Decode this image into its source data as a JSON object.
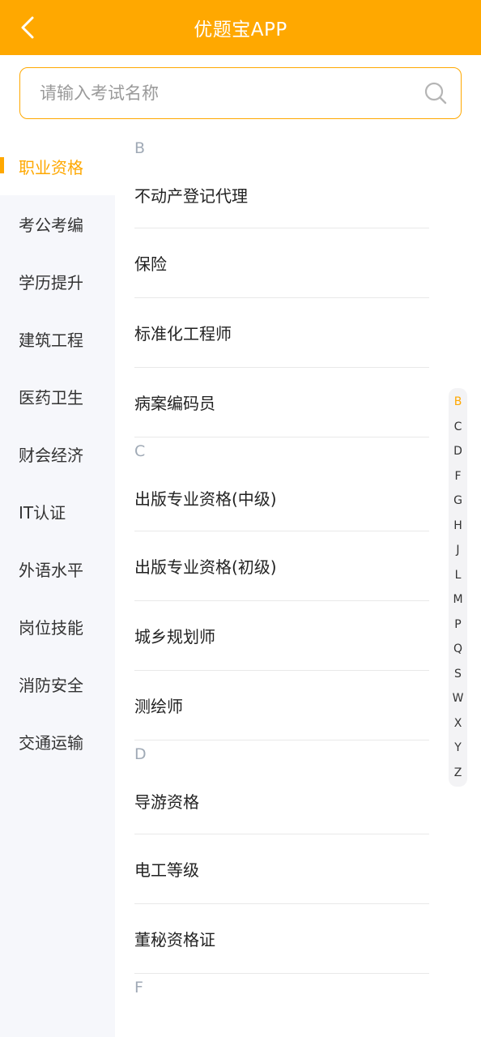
{
  "header": {
    "title": "优题宝APP"
  },
  "search": {
    "placeholder": "请输入考试名称",
    "value": ""
  },
  "sidebar": {
    "items": [
      {
        "label": "职业资格",
        "active": true
      },
      {
        "label": "考公考编",
        "active": false
      },
      {
        "label": "学历提升",
        "active": false
      },
      {
        "label": "建筑工程",
        "active": false
      },
      {
        "label": "医药卫生",
        "active": false
      },
      {
        "label": "财会经济",
        "active": false
      },
      {
        "label": "IT认证",
        "active": false
      },
      {
        "label": "外语水平",
        "active": false
      },
      {
        "label": "岗位技能",
        "active": false
      },
      {
        "label": "消防安全",
        "active": false
      },
      {
        "label": "交通运输",
        "active": false
      }
    ]
  },
  "groups": [
    {
      "letter": "B",
      "items": [
        "不动产登记代理",
        "保险",
        "标准化工程师",
        "病案编码员"
      ]
    },
    {
      "letter": "C",
      "items": [
        "出版专业资格(中级)",
        "出版专业资格(初级)",
        "城乡规划师",
        "测绘师"
      ]
    },
    {
      "letter": "D",
      "items": [
        "导游资格",
        "电工等级",
        "董秘资格证"
      ]
    },
    {
      "letter": "F",
      "items": []
    }
  ],
  "alphabet": {
    "letters": [
      "B",
      "C",
      "D",
      "F",
      "G",
      "H",
      "J",
      "L",
      "M",
      "P",
      "Q",
      "S",
      "W",
      "X",
      "Y",
      "Z"
    ],
    "active": "B"
  },
  "colors": {
    "accent": "#FFA800",
    "sidebar_bg": "#F6F7FB",
    "group_letter": "#A0AAB6"
  },
  "icons": {
    "back": "chevron-left-icon",
    "search": "search-icon"
  }
}
